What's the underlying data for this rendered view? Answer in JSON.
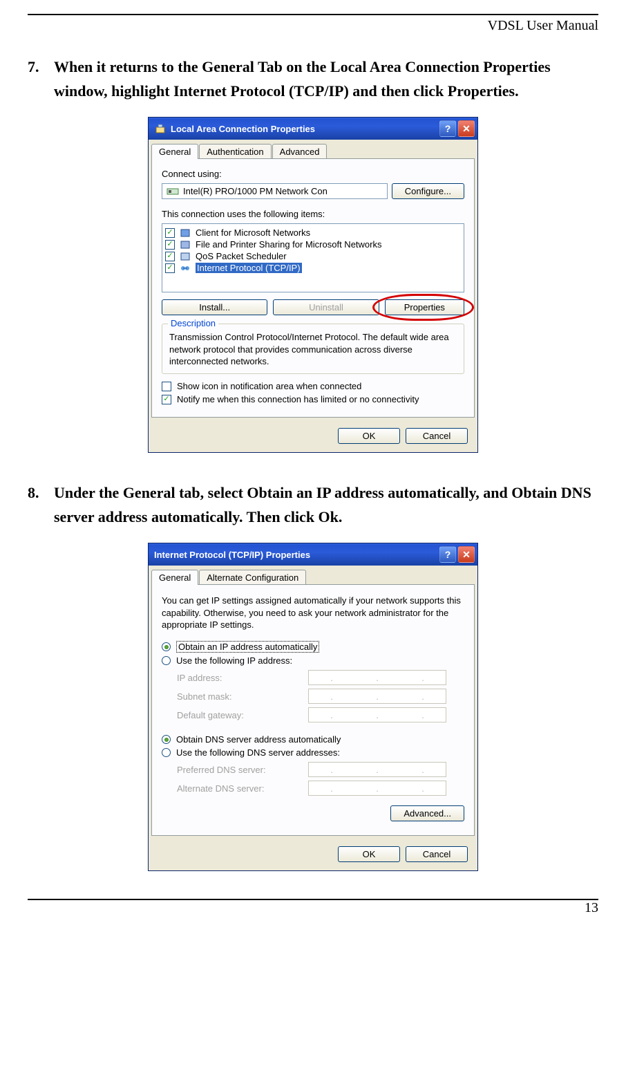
{
  "doc": {
    "header": "VDSL User Manual",
    "page_number": "13"
  },
  "steps": {
    "s7": {
      "num": "7.",
      "text": "When it returns to the General Tab on the Local Area Connection Properties window, highlight Internet Protocol (TCP/IP) and then click Properties."
    },
    "s8": {
      "num": "8.",
      "text": "Under the General tab, select Obtain an IP address automatically, and Obtain DNS server address automatically. Then click Ok."
    }
  },
  "win1": {
    "title": "Local Area Connection Properties",
    "tabs": {
      "general": "General",
      "auth": "Authentication",
      "adv": "Advanced"
    },
    "connect_using": "Connect using:",
    "adapter": "Intel(R) PRO/1000 PM Network Con",
    "configure": "Configure...",
    "items_label": "This connection uses the following items:",
    "items": [
      {
        "label": "Client for Microsoft Networks"
      },
      {
        "label": "File and Printer Sharing for Microsoft Networks"
      },
      {
        "label": "QoS Packet Scheduler"
      },
      {
        "label": "Internet Protocol (TCP/IP)"
      }
    ],
    "install": "Install...",
    "uninstall": "Uninstall",
    "properties": "Properties",
    "description_title": "Description",
    "description_text": "Transmission Control Protocol/Internet Protocol. The default wide area network protocol that provides communication across diverse interconnected networks.",
    "show_icon": "Show icon in notification area when connected",
    "notify": "Notify me when this connection has limited or no connectivity",
    "ok": "OK",
    "cancel": "Cancel"
  },
  "win2": {
    "title": "Internet Protocol (TCP/IP) Properties",
    "tabs": {
      "general": "General",
      "alt": "Alternate Configuration"
    },
    "intro": "You can get IP settings assigned automatically if your network supports this capability. Otherwise, you need to ask your network administrator for the appropriate IP settings.",
    "obtain_ip": "Obtain an IP address automatically",
    "use_ip": "Use the following IP address:",
    "ip": "IP address:",
    "subnet": "Subnet mask:",
    "gateway": "Default gateway:",
    "obtain_dns": "Obtain DNS server address automatically",
    "use_dns": "Use the following DNS server addresses:",
    "pref_dns": "Preferred DNS server:",
    "alt_dns": "Alternate DNS server:",
    "advanced": "Advanced...",
    "ok": "OK",
    "cancel": "Cancel"
  }
}
